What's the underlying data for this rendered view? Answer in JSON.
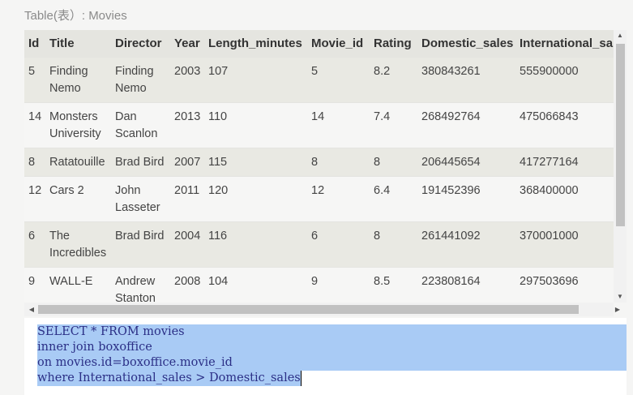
{
  "caption": "Table(表）: Movies",
  "table": {
    "columns": [
      "Id",
      "Title",
      "Director",
      "Year",
      "Length_minutes",
      "Movie_id",
      "Rating",
      "Domestic_sales",
      "International_sales"
    ],
    "rows": [
      [
        "5",
        "Finding Nemo",
        "Finding Nemo",
        "2003",
        "107",
        "5",
        "8.2",
        "380843261",
        "555900000"
      ],
      [
        "14",
        "Monsters University",
        "Dan Scanlon",
        "2013",
        "110",
        "14",
        "7.4",
        "268492764",
        "475066843"
      ],
      [
        "8",
        "Ratatouille",
        "Brad Bird",
        "2007",
        "115",
        "8",
        "8",
        "206445654",
        "417277164"
      ],
      [
        "12",
        "Cars 2",
        "John Lasseter",
        "2011",
        "120",
        "12",
        "6.4",
        "191452396",
        "368400000"
      ],
      [
        "6",
        "The Incredibles",
        "Brad Bird",
        "2004",
        "116",
        "6",
        "8",
        "261441092",
        "370001000"
      ],
      [
        "9",
        "WALL-E",
        "Andrew Stanton",
        "2008",
        "104",
        "9",
        "8.5",
        "223808164",
        "297503696"
      ]
    ]
  },
  "scrollbar": {
    "up_icon": "triangle-up-icon",
    "down_icon": "triangle-down-icon",
    "left_icon": "triangle-left-icon",
    "right_icon": "triangle-right-icon"
  },
  "editor": {
    "lines": [
      "SELECT * FROM movies",
      "inner join boxoffice",
      "on movies.id=boxoffice.movie_id",
      "where International_sales > Domestic_sales"
    ],
    "selection_color": "#a9cbf5",
    "text_color": "#2b2f86"
  }
}
